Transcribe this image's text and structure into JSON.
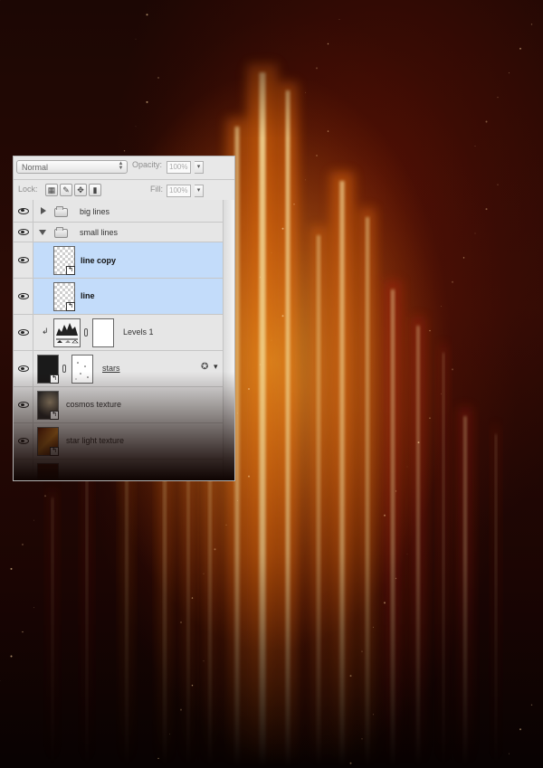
{
  "panel": {
    "blend_mode": "Normal",
    "opacity_label": "Opacity:",
    "opacity_value": "100%",
    "lock_label": "Lock:",
    "fill_label": "Fill:",
    "fill_value": "100%"
  },
  "layers": [
    {
      "name": "big lines",
      "kind": "group",
      "state": "collapsed"
    },
    {
      "name": "small lines",
      "kind": "group",
      "state": "expanded"
    },
    {
      "name": "line copy",
      "kind": "smart-object",
      "selected": true
    },
    {
      "name": "line",
      "kind": "smart-object",
      "selected": true
    },
    {
      "name": "Levels 1",
      "kind": "adjustment-levels"
    },
    {
      "name": "stars",
      "kind": "smart-object-with-mask"
    },
    {
      "name": "cosmos texture",
      "kind": "smart-object"
    },
    {
      "name": "star light texture",
      "kind": "smart-object"
    }
  ],
  "colors": {
    "selection": "#c3dcfa",
    "panel_bg": "#e8e8e8",
    "beam_core": "#fff2b0",
    "beam_orange": "#ff7a10",
    "beam_red": "#c4200a"
  }
}
